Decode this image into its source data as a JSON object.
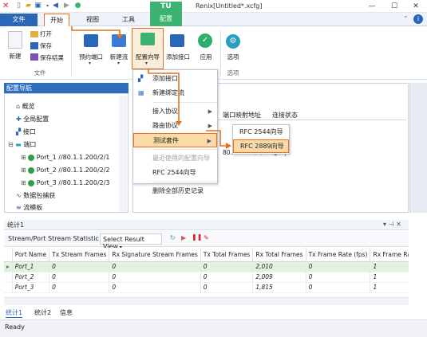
{
  "window": {
    "title": "Renix[Untitled*.xcfg]",
    "controls": {
      "minimize": "—",
      "maximize": "☐",
      "close": "✕"
    }
  },
  "ribbon": {
    "tabs": {
      "file": "文件",
      "start": "开始",
      "view": "视图",
      "tools": "工具",
      "config_top": "TU",
      "config": "配置"
    },
    "file_group": {
      "new": "新建",
      "open": "打开",
      "save": "保存",
      "save_result": "保存结果",
      "label": "文件"
    },
    "buttons": {
      "reserve_port": "预约端口",
      "new_stream": "新建流",
      "config_wizard": "配置向导",
      "add_interface": "添加接口",
      "apply": "应用",
      "options": "选项"
    },
    "options_group_label": "选项"
  },
  "nav": {
    "title": "配置导航",
    "items": [
      "概览",
      "全局配置",
      "接口",
      "端口",
      "Port_1 //80.1.1.200/2/1",
      "Port_2 //80.1.1.200/2/2",
      "Port_3 //80.1.1.200/2/3",
      "数据包捕获",
      "流模板"
    ]
  },
  "right_table": {
    "headers": [
      "端口映射地址",
      "连接状态"
    ],
    "rows": [
      [
        "80.1.1.200/2/3",
        "● Up"
      ]
    ]
  },
  "dropdown": {
    "items": [
      "添加接口",
      "新建绑定流",
      "接入协议",
      "路由协议",
      "测试套件",
      "最近使用的配置向导",
      "RFC 2544向导",
      "删除全部历史记录"
    ]
  },
  "submenu": {
    "items": [
      "RFC 2544向导",
      "RFC 2889向导"
    ]
  },
  "stats": {
    "panel_title": "统计1",
    "view_label": "Stream/Port Stream Statistic",
    "select_view": "Select Result View",
    "columns": [
      "Port Name",
      "Tx Stream Frames",
      "Rx Signature Stream Frames",
      "Tx Total Frames",
      "Rx Total Frames",
      "Tx Frame Rate (fps)",
      "Rx Frame Ra"
    ],
    "rows": [
      [
        "Port_1",
        "0",
        "0",
        "0",
        "2,010",
        "0",
        "1"
      ],
      [
        "Port_2",
        "0",
        "0",
        "0",
        "2,009",
        "0",
        "1"
      ],
      [
        "Port_3",
        "0",
        "0",
        "0",
        "1,815",
        "0",
        "1"
      ]
    ],
    "bottom_tabs": [
      "统计1",
      "统计2",
      "信息"
    ]
  },
  "status": "Ready",
  "colors": {
    "accent_blue": "#2a67b8",
    "highlight_orange": "#e7711b",
    "config_green": "#3cb371",
    "menu_highlight": "#f6c77a"
  }
}
